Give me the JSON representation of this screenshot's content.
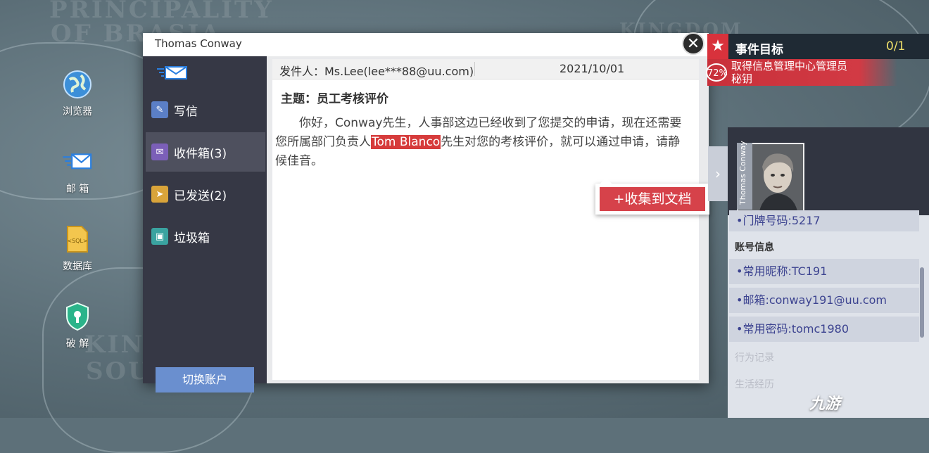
{
  "background": {
    "map_labels": [
      "PRINCIPALITY",
      "OF BRASIA",
      "KINGD",
      "SOUTH",
      "KINGDOM"
    ]
  },
  "desktop": {
    "icons": [
      {
        "label": "浏览器",
        "icon": "globe-icon"
      },
      {
        "label": "邮 箱",
        "icon": "mail-icon"
      },
      {
        "label": "数据库",
        "icon": "sql-file-icon"
      },
      {
        "label": "破 解",
        "icon": "shield-key-icon"
      }
    ]
  },
  "mail_window": {
    "title": "Thomas Conway",
    "sidebar": {
      "items": [
        {
          "label": "写信",
          "icon": "compose-icon",
          "color": "#5b7fc6"
        },
        {
          "label": "收件箱(3)",
          "icon": "inbox-icon",
          "color": "#7b5fb8",
          "active": true
        },
        {
          "label": "已发送(2)",
          "icon": "sent-icon",
          "color": "#d9a43a"
        },
        {
          "label": "垃圾箱",
          "icon": "trash-icon",
          "color": "#3aa3a0"
        }
      ],
      "switch_account": "切换账户"
    },
    "message": {
      "sender": "发件人：Ms.Lee(lee***88@uu.com)",
      "date": "2021/10/01",
      "subject": "主题：员工考核评价",
      "body_part1": "　　你好，Conway先生，人事部这边已经收到了您提交的申请，现在还需要您所属部门负责人",
      "highlight": "Tom Blanco",
      "body_part2": "先生对您的考核评价，就可以通过申请，请静候佳音。"
    },
    "collect_button": "+收集到文档"
  },
  "event_goal": {
    "title": "事件目标",
    "count": "0/1",
    "progress_label": "72%",
    "description_line1": "取得信息管理中心管理员",
    "description_line2": "秘钥"
  },
  "profile": {
    "name": "Thomas Conway",
    "partial_row": "•门牌号码:5217",
    "section_account": "账号信息",
    "fields": [
      "•常用昵称:TC191",
      "•邮箱:conway191@uu.com",
      "•常用密码:tomc1980"
    ],
    "section_behavior": "行为记录",
    "section_life": "生活经历"
  },
  "watermark": "九游"
}
